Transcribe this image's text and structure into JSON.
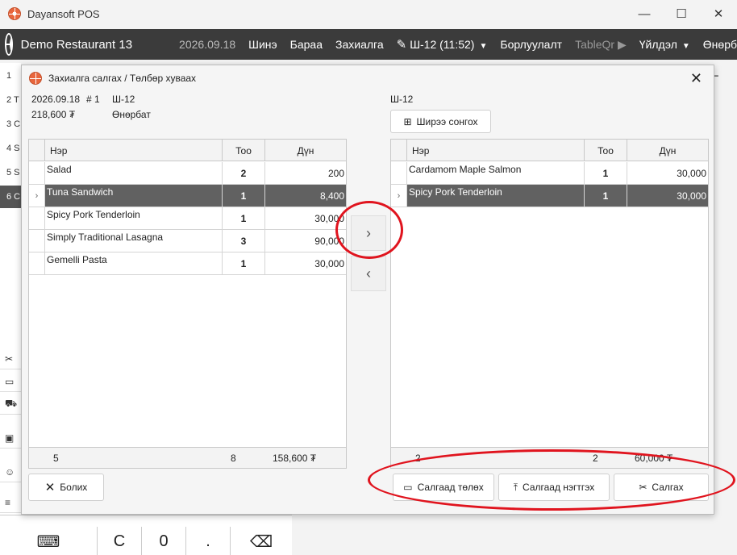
{
  "app": {
    "title": "Dayansoft POS",
    "window_controls": {
      "minimize": "—",
      "maximize": "☐",
      "close": "✕"
    }
  },
  "menubar": {
    "restaurant": "Demo Restaurant 13",
    "date": "2026.09.18",
    "items": [
      "Шинэ",
      "Бараа",
      "Захиалга"
    ],
    "table_indicator": "Ш-12 (11:52)",
    "sales": "Борлуулалт",
    "tableqr": "TableQr",
    "actions": "Үйлдэл",
    "user_partial": "Өнөрб"
  },
  "background": {
    "left_rows": [
      "1",
      "2 T",
      "3 C",
      "4 S",
      "5 S",
      "6 C"
    ],
    "plus": "+"
  },
  "keypad": {
    "keys": [
      "C",
      "0",
      "."
    ]
  },
  "dialog": {
    "title": "Захиалга салгах / Төлбөр хуваах",
    "left_info": {
      "date": "2026.09.18",
      "number": "# 1",
      "table": "Ш-12",
      "amount": "218,600 ₮",
      "waiter": "Өнөрбат"
    },
    "right_info": {
      "table": "Ш-12"
    },
    "select_table_button": "Ширээ сонгох",
    "columns": {
      "name": "Нэр",
      "qty": "Тоо",
      "amount": "Дүн"
    },
    "left_table": {
      "rows": [
        {
          "name": "Salad",
          "qty": "2",
          "amount": "200",
          "selected": false
        },
        {
          "name": "Tuna Sandwich",
          "qty": "1",
          "amount": "8,400",
          "selected": true
        },
        {
          "name": "Spicy Pork Tenderloin",
          "qty": "1",
          "amount": "30,000",
          "selected": false
        },
        {
          "name": "Simply Traditional Lasagna",
          "qty": "3",
          "amount": "90,000",
          "selected": false
        },
        {
          "name": "Gemelli Pasta",
          "qty": "1",
          "amount": "30,000",
          "selected": false
        }
      ],
      "footer": {
        "count": "5",
        "qty": "8",
        "total": "158,600 ₮"
      }
    },
    "right_table": {
      "rows": [
        {
          "name": "Cardamom Maple Salmon",
          "qty": "1",
          "amount": "30,000",
          "selected": false
        },
        {
          "name": "Spicy Pork Tenderloin",
          "qty": "1",
          "amount": "30,000",
          "selected": true
        }
      ],
      "footer": {
        "count": "2",
        "qty": "2",
        "total": "60,000 ₮"
      }
    },
    "move_right": "›",
    "move_left": "‹",
    "cancel_button": "Болих",
    "split_pay_button": "Салгаад төлөх",
    "split_merge_button": "Салгаад нэгтгэх",
    "split_button": "Салгах",
    "close": "✕"
  },
  "accent_colors": {
    "menubar": "#3b3b3b",
    "selected_row": "#616161",
    "annotation": "#e0141e",
    "logo": "#e8663d"
  }
}
